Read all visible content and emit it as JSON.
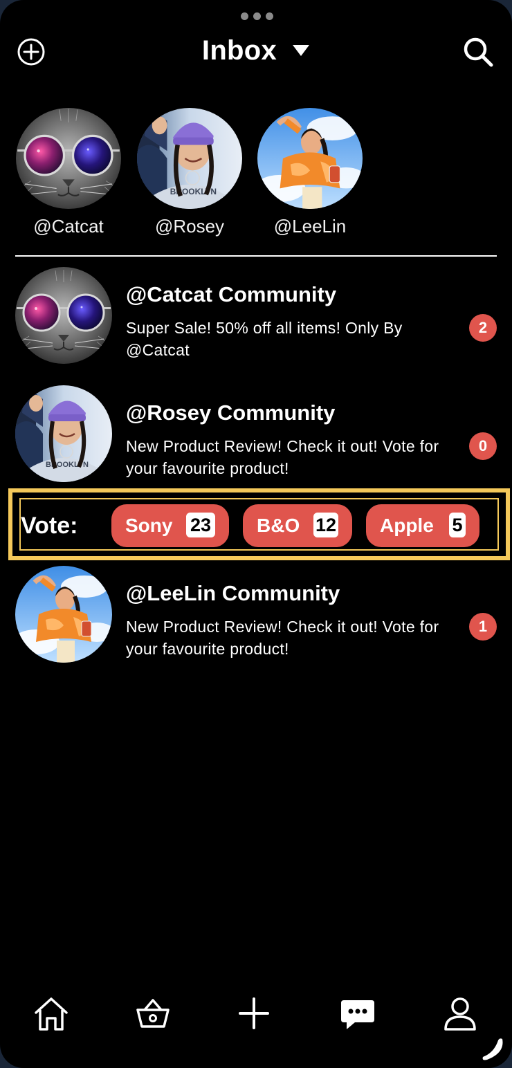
{
  "header": {
    "title": "Inbox",
    "add_icon": "plus-circle-icon",
    "dropdown_icon": "caret-down-icon",
    "search_icon": "search-icon"
  },
  "stories": [
    {
      "handle": "@Catcat",
      "avatar": "cat-with-sunglasses"
    },
    {
      "handle": "@Rosey",
      "avatar": "woman-purple-beanie"
    },
    {
      "handle": "@LeeLin",
      "avatar": "woman-orange-jacket"
    }
  ],
  "conversations": [
    {
      "title": "@Catcat Community",
      "message": "Super Sale! 50% off all items! Only By @Catcat",
      "unread": "2"
    },
    {
      "title": "@Rosey Community",
      "message": "New Product Review! Check it out! Vote for your favourite product!",
      "unread": "0"
    },
    {
      "title": "@LeeLin Community",
      "message": "New Product Review! Check it out! Vote for your favourite product!",
      "unread": "1"
    }
  ],
  "vote": {
    "label": "Vote:",
    "options": [
      {
        "name": "Sony",
        "count": "23"
      },
      {
        "name": "B&O",
        "count": "12"
      },
      {
        "name": "Apple",
        "count": "5"
      }
    ],
    "highlight_color": "#f5c95a"
  },
  "tabbar": {
    "items": [
      {
        "icon": "home-icon"
      },
      {
        "icon": "basket-icon"
      },
      {
        "icon": "plus-icon"
      },
      {
        "icon": "chat-icon"
      },
      {
        "icon": "profile-icon"
      }
    ]
  },
  "colors": {
    "accent": "#e0554d",
    "background": "#000000",
    "text": "#ffffff"
  }
}
